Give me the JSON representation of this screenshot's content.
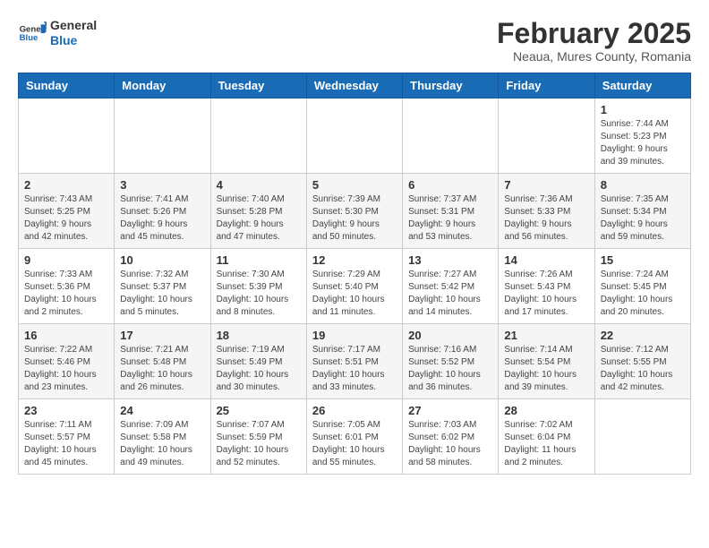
{
  "header": {
    "logo_general": "General",
    "logo_blue": "Blue",
    "month_year": "February 2025",
    "location": "Neaua, Mures County, Romania"
  },
  "weekdays": [
    "Sunday",
    "Monday",
    "Tuesday",
    "Wednesday",
    "Thursday",
    "Friday",
    "Saturday"
  ],
  "weeks": [
    [
      {
        "day": "",
        "info": ""
      },
      {
        "day": "",
        "info": ""
      },
      {
        "day": "",
        "info": ""
      },
      {
        "day": "",
        "info": ""
      },
      {
        "day": "",
        "info": ""
      },
      {
        "day": "",
        "info": ""
      },
      {
        "day": "1",
        "info": "Sunrise: 7:44 AM\nSunset: 5:23 PM\nDaylight: 9 hours and 39 minutes."
      }
    ],
    [
      {
        "day": "2",
        "info": "Sunrise: 7:43 AM\nSunset: 5:25 PM\nDaylight: 9 hours and 42 minutes."
      },
      {
        "day": "3",
        "info": "Sunrise: 7:41 AM\nSunset: 5:26 PM\nDaylight: 9 hours and 45 minutes."
      },
      {
        "day": "4",
        "info": "Sunrise: 7:40 AM\nSunset: 5:28 PM\nDaylight: 9 hours and 47 minutes."
      },
      {
        "day": "5",
        "info": "Sunrise: 7:39 AM\nSunset: 5:30 PM\nDaylight: 9 hours and 50 minutes."
      },
      {
        "day": "6",
        "info": "Sunrise: 7:37 AM\nSunset: 5:31 PM\nDaylight: 9 hours and 53 minutes."
      },
      {
        "day": "7",
        "info": "Sunrise: 7:36 AM\nSunset: 5:33 PM\nDaylight: 9 hours and 56 minutes."
      },
      {
        "day": "8",
        "info": "Sunrise: 7:35 AM\nSunset: 5:34 PM\nDaylight: 9 hours and 59 minutes."
      }
    ],
    [
      {
        "day": "9",
        "info": "Sunrise: 7:33 AM\nSunset: 5:36 PM\nDaylight: 10 hours and 2 minutes."
      },
      {
        "day": "10",
        "info": "Sunrise: 7:32 AM\nSunset: 5:37 PM\nDaylight: 10 hours and 5 minutes."
      },
      {
        "day": "11",
        "info": "Sunrise: 7:30 AM\nSunset: 5:39 PM\nDaylight: 10 hours and 8 minutes."
      },
      {
        "day": "12",
        "info": "Sunrise: 7:29 AM\nSunset: 5:40 PM\nDaylight: 10 hours and 11 minutes."
      },
      {
        "day": "13",
        "info": "Sunrise: 7:27 AM\nSunset: 5:42 PM\nDaylight: 10 hours and 14 minutes."
      },
      {
        "day": "14",
        "info": "Sunrise: 7:26 AM\nSunset: 5:43 PM\nDaylight: 10 hours and 17 minutes."
      },
      {
        "day": "15",
        "info": "Sunrise: 7:24 AM\nSunset: 5:45 PM\nDaylight: 10 hours and 20 minutes."
      }
    ],
    [
      {
        "day": "16",
        "info": "Sunrise: 7:22 AM\nSunset: 5:46 PM\nDaylight: 10 hours and 23 minutes."
      },
      {
        "day": "17",
        "info": "Sunrise: 7:21 AM\nSunset: 5:48 PM\nDaylight: 10 hours and 26 minutes."
      },
      {
        "day": "18",
        "info": "Sunrise: 7:19 AM\nSunset: 5:49 PM\nDaylight: 10 hours and 30 minutes."
      },
      {
        "day": "19",
        "info": "Sunrise: 7:17 AM\nSunset: 5:51 PM\nDaylight: 10 hours and 33 minutes."
      },
      {
        "day": "20",
        "info": "Sunrise: 7:16 AM\nSunset: 5:52 PM\nDaylight: 10 hours and 36 minutes."
      },
      {
        "day": "21",
        "info": "Sunrise: 7:14 AM\nSunset: 5:54 PM\nDaylight: 10 hours and 39 minutes."
      },
      {
        "day": "22",
        "info": "Sunrise: 7:12 AM\nSunset: 5:55 PM\nDaylight: 10 hours and 42 minutes."
      }
    ],
    [
      {
        "day": "23",
        "info": "Sunrise: 7:11 AM\nSunset: 5:57 PM\nDaylight: 10 hours and 45 minutes."
      },
      {
        "day": "24",
        "info": "Sunrise: 7:09 AM\nSunset: 5:58 PM\nDaylight: 10 hours and 49 minutes."
      },
      {
        "day": "25",
        "info": "Sunrise: 7:07 AM\nSunset: 5:59 PM\nDaylight: 10 hours and 52 minutes."
      },
      {
        "day": "26",
        "info": "Sunrise: 7:05 AM\nSunset: 6:01 PM\nDaylight: 10 hours and 55 minutes."
      },
      {
        "day": "27",
        "info": "Sunrise: 7:03 AM\nSunset: 6:02 PM\nDaylight: 10 hours and 58 minutes."
      },
      {
        "day": "28",
        "info": "Sunrise: 7:02 AM\nSunset: 6:04 PM\nDaylight: 11 hours and 2 minutes."
      },
      {
        "day": "",
        "info": ""
      }
    ]
  ]
}
